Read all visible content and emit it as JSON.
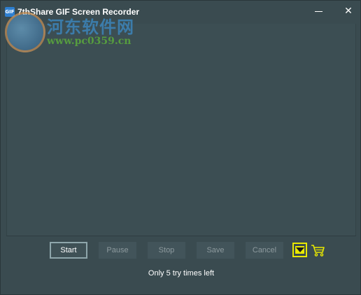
{
  "window": {
    "title": "7thShare GIF Screen Recorder",
    "app_icon_label": "GIF"
  },
  "watermark": {
    "text_cn": "河东软件网",
    "url": "www.pc0359.cn"
  },
  "toolbar": {
    "start_label": "Start",
    "pause_label": "Pause",
    "stop_label": "Stop",
    "save_label": "Save",
    "cancel_label": "Cancel",
    "dropdown_icon": "chevron-down-icon",
    "cart_icon": "cart-icon"
  },
  "status": {
    "message": "Only 5 try times left"
  },
  "colors": {
    "background": "#3a4b50",
    "accent_highlight": "#e8e800",
    "text": "#ffffff",
    "disabled_text": "#8d9a9e"
  }
}
